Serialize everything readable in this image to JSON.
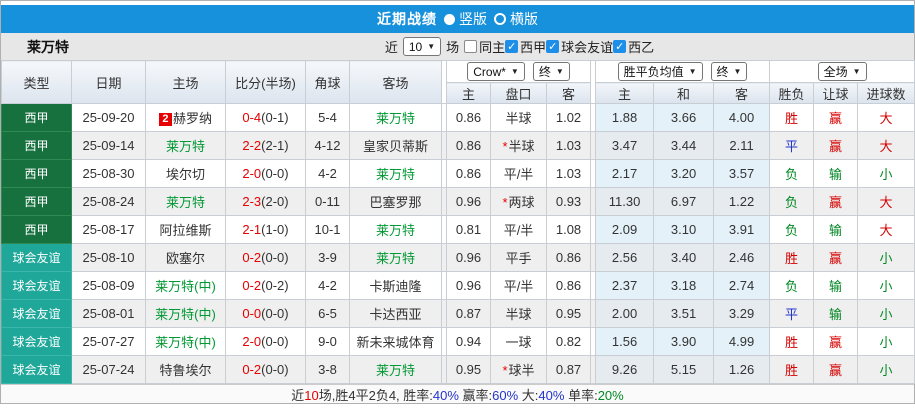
{
  "title_bar": {
    "title": "近期战绩",
    "radio_vertical": "竖版",
    "radio_horizontal": "横版"
  },
  "team_bar": {
    "team": "莱万特",
    "near_label": "近",
    "matches_select": "10",
    "matches_label": "场",
    "filters": [
      {
        "label": "同主",
        "checked": false
      },
      {
        "label": "西甲",
        "checked": true
      },
      {
        "label": "球会友谊",
        "checked": true
      },
      {
        "label": "西乙",
        "checked": true
      }
    ]
  },
  "dropdowns": {
    "odds_company": "Crow*",
    "odds_time": "终",
    "europe": "胜平负均值",
    "europe_time": "终",
    "scope": "全场"
  },
  "table": {
    "headers": [
      "类型",
      "日期",
      "主场",
      "比分(半场)",
      "角球",
      "客场",
      "主",
      "盘口",
      "客",
      "主",
      "和",
      "客",
      "胜负",
      "让球",
      "进球数"
    ],
    "rows": [
      {
        "type": "西甲",
        "type_class": "liga",
        "date": "25-09-20",
        "home": "赫罗纳",
        "home_green": false,
        "home_badge": "2",
        "score": "0-4",
        "half": "(0-1)",
        "corners": "5-4",
        "away": "莱万特",
        "away_green": true,
        "asia_home": "0.86",
        "handicap": "半球",
        "handicap_star": false,
        "asia_away": "1.02",
        "euro_home": "1.88",
        "euro_draw": "3.66",
        "euro_away": "4.00",
        "result_wdl": "胜",
        "result_wdl_class": "red",
        "result_handicap": "赢",
        "result_handicap_class": "red",
        "result_ou": "大",
        "result_ou_class": "red"
      },
      {
        "type": "西甲",
        "type_class": "liga",
        "date": "25-09-14",
        "home": "莱万特",
        "home_green": true,
        "home_badge": null,
        "score": "2-2",
        "half": "(2-1)",
        "corners": "4-12",
        "away": "皇家贝蒂斯",
        "away_green": false,
        "asia_home": "0.86",
        "handicap": "半球",
        "handicap_star": true,
        "asia_away": "1.03",
        "euro_home": "3.47",
        "euro_draw": "3.44",
        "euro_away": "2.11",
        "result_wdl": "平",
        "result_wdl_class": "blue",
        "result_handicap": "赢",
        "result_handicap_class": "red",
        "result_ou": "大",
        "result_ou_class": "red"
      },
      {
        "type": "西甲",
        "type_class": "liga",
        "date": "25-08-30",
        "home": "埃尔切",
        "home_green": false,
        "home_badge": null,
        "score": "2-0",
        "half": "(0-0)",
        "corners": "4-2",
        "away": "莱万特",
        "away_green": true,
        "asia_home": "0.86",
        "handicap": "平/半",
        "handicap_star": false,
        "asia_away": "1.03",
        "euro_home": "2.17",
        "euro_draw": "3.20",
        "euro_away": "3.57",
        "result_wdl": "负",
        "result_wdl_class": "green",
        "result_handicap": "输",
        "result_handicap_class": "green",
        "result_ou": "小",
        "result_ou_class": "green"
      },
      {
        "type": "西甲",
        "type_class": "liga",
        "date": "25-08-24",
        "home": "莱万特",
        "home_green": true,
        "home_badge": null,
        "score": "2-3",
        "half": "(2-0)",
        "corners": "0-11",
        "away": "巴塞罗那",
        "away_green": false,
        "asia_home": "0.96",
        "handicap": "两球",
        "handicap_star": true,
        "asia_away": "0.93",
        "euro_home": "11.30",
        "euro_draw": "6.97",
        "euro_away": "1.22",
        "result_wdl": "负",
        "result_wdl_class": "green",
        "result_handicap": "赢",
        "result_handicap_class": "red",
        "result_ou": "大",
        "result_ou_class": "red"
      },
      {
        "type": "西甲",
        "type_class": "liga",
        "date": "25-08-17",
        "home": "阿拉维斯",
        "home_green": false,
        "home_badge": null,
        "score": "2-1",
        "half": "(1-0)",
        "corners": "10-1",
        "away": "莱万特",
        "away_green": true,
        "asia_home": "0.81",
        "handicap": "平/半",
        "handicap_star": false,
        "asia_away": "1.08",
        "euro_home": "2.09",
        "euro_draw": "3.10",
        "euro_away": "3.91",
        "result_wdl": "负",
        "result_wdl_class": "green",
        "result_handicap": "输",
        "result_handicap_class": "green",
        "result_ou": "大",
        "result_ou_class": "red"
      },
      {
        "type": "球会友谊",
        "type_class": "friendly",
        "date": "25-08-10",
        "home": "欧塞尔",
        "home_green": false,
        "home_badge": null,
        "score": "0-2",
        "half": "(0-0)",
        "corners": "3-9",
        "away": "莱万特",
        "away_green": true,
        "asia_home": "0.96",
        "handicap": "平手",
        "handicap_star": false,
        "asia_away": "0.86",
        "euro_home": "2.56",
        "euro_draw": "3.40",
        "euro_away": "2.46",
        "result_wdl": "胜",
        "result_wdl_class": "red",
        "result_handicap": "赢",
        "result_handicap_class": "red",
        "result_ou": "小",
        "result_ou_class": "green"
      },
      {
        "type": "球会友谊",
        "type_class": "friendly",
        "date": "25-08-09",
        "home": "莱万特(中)",
        "home_green": true,
        "home_badge": null,
        "score": "0-2",
        "half": "(0-2)",
        "corners": "4-2",
        "away": "卡斯迪隆",
        "away_green": false,
        "asia_home": "0.96",
        "handicap": "平/半",
        "handicap_star": false,
        "asia_away": "0.86",
        "euro_home": "2.37",
        "euro_draw": "3.18",
        "euro_away": "2.74",
        "result_wdl": "负",
        "result_wdl_class": "green",
        "result_handicap": "输",
        "result_handicap_class": "green",
        "result_ou": "小",
        "result_ou_class": "green"
      },
      {
        "type": "球会友谊",
        "type_class": "friendly",
        "date": "25-08-01",
        "home": "莱万特(中)",
        "home_green": true,
        "home_badge": null,
        "score": "0-0",
        "half": "(0-0)",
        "corners": "6-5",
        "away": "卡达西亚",
        "away_green": false,
        "asia_home": "0.87",
        "handicap": "半球",
        "handicap_star": false,
        "asia_away": "0.95",
        "euro_home": "2.00",
        "euro_draw": "3.51",
        "euro_away": "3.29",
        "result_wdl": "平",
        "result_wdl_class": "blue",
        "result_handicap": "输",
        "result_handicap_class": "green",
        "result_ou": "小",
        "result_ou_class": "green"
      },
      {
        "type": "球会友谊",
        "type_class": "friendly",
        "date": "25-07-27",
        "home": "莱万特(中)",
        "home_green": true,
        "home_badge": null,
        "score": "2-0",
        "half": "(0-0)",
        "corners": "9-0",
        "away": "新未来城体育",
        "away_green": false,
        "asia_home": "0.94",
        "handicap": "一球",
        "handicap_star": false,
        "asia_away": "0.82",
        "euro_home": "1.56",
        "euro_draw": "3.90",
        "euro_away": "4.99",
        "result_wdl": "胜",
        "result_wdl_class": "red",
        "result_handicap": "赢",
        "result_handicap_class": "red",
        "result_ou": "小",
        "result_ou_class": "green"
      },
      {
        "type": "球会友谊",
        "type_class": "friendly",
        "date": "25-07-24",
        "home": "特鲁埃尔",
        "home_green": false,
        "home_badge": null,
        "score": "0-2",
        "half": "(0-0)",
        "corners": "3-8",
        "away": "莱万特",
        "away_green": true,
        "asia_home": "0.95",
        "handicap": "球半",
        "handicap_star": true,
        "asia_away": "0.87",
        "euro_home": "9.26",
        "euro_draw": "5.15",
        "euro_away": "1.26",
        "result_wdl": "胜",
        "result_wdl_class": "red",
        "result_handicap": "赢",
        "result_handicap_class": "red",
        "result_ou": "小",
        "result_ou_class": "green"
      }
    ]
  },
  "footer": {
    "segments": [
      {
        "text": "近",
        "color": "#333333"
      },
      {
        "text": "10",
        "color": "#e60000"
      },
      {
        "text": "场,胜4平2负4, 胜率:",
        "color": "#333333"
      },
      {
        "text": "40%",
        "color": "#2233cc"
      },
      {
        "text": " 赢率:",
        "color": "#333333"
      },
      {
        "text": "60%",
        "color": "#2233cc"
      },
      {
        "text": " 大:",
        "color": "#333333"
      },
      {
        "text": "40%",
        "color": "#2233cc"
      },
      {
        "text": " 单率:",
        "color": "#333333"
      },
      {
        "text": "20%",
        "color": "#008822"
      }
    ]
  },
  "colors": {
    "title_bar_bg": "#1791dc",
    "liga_bg": "#17713e",
    "friendly_bg": "#1fa89a",
    "levante_green": "#009933",
    "score_red": "#e60000",
    "checked_blue": "#1e8fe8"
  }
}
